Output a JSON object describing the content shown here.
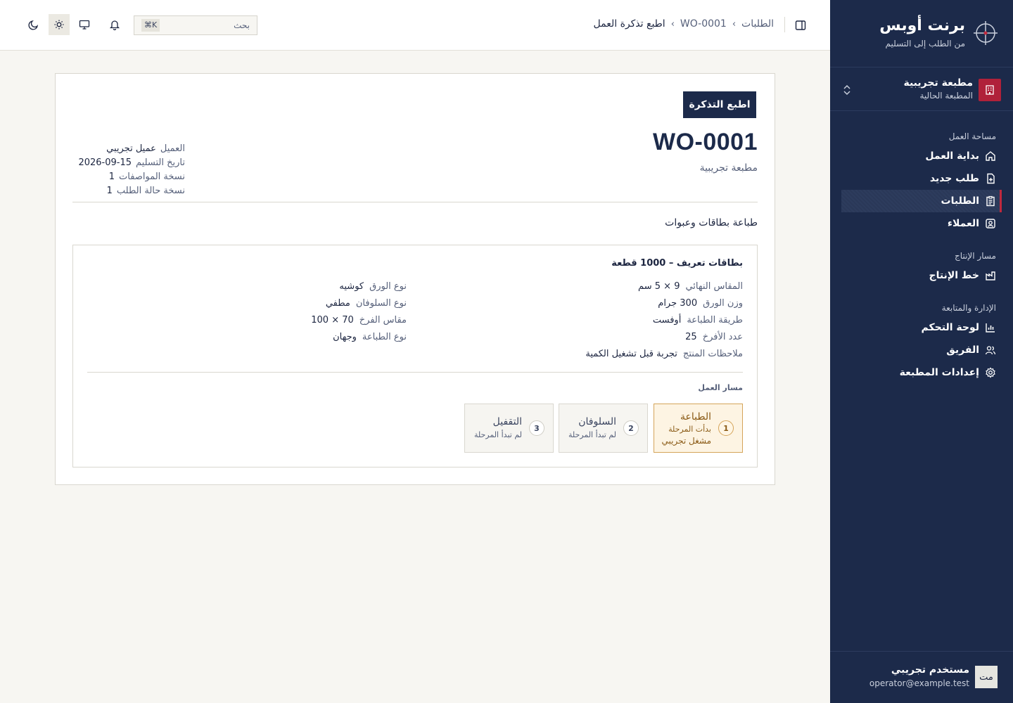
{
  "brand": {
    "title": "برنت أوبس",
    "subtitle": "من الطلب إلى التسليم"
  },
  "org": {
    "name": "مطبعة تجريبية",
    "subtitle": "المطبعة الحالية"
  },
  "nav": {
    "sections": [
      {
        "title": "مساحة العمل",
        "items": [
          {
            "label": "بداية العمل",
            "icon": "home-icon"
          },
          {
            "label": "طلب جديد",
            "icon": "file-plus-icon"
          },
          {
            "label": "الطلبات",
            "icon": "clipboard-icon",
            "active": true
          },
          {
            "label": "العملاء",
            "icon": "contact-icon"
          }
        ]
      },
      {
        "title": "مسار الإنتاج",
        "items": [
          {
            "label": "خط الإنتاج",
            "icon": "factory-icon"
          }
        ]
      },
      {
        "title": "الإدارة والمتابعة",
        "items": [
          {
            "label": "لوحة التحكم",
            "icon": "bar-chart-icon"
          },
          {
            "label": "الفريق",
            "icon": "users-icon"
          },
          {
            "label": "إعدادات المطبعة",
            "icon": "gear-icon"
          }
        ]
      }
    ]
  },
  "user": {
    "initials": "مت",
    "name": "مستخدم تجريبي",
    "email": "operator@example.test"
  },
  "topbar": {
    "breadcrumb": {
      "root": "الطلبات",
      "order": "WO-0001",
      "current": "اطبع تذكرة العمل"
    },
    "search": {
      "placeholder": "بحث",
      "shortcut": "⌘K"
    }
  },
  "ticket": {
    "print_label": "اطبع التذكرة",
    "number": "WO-0001",
    "shop": "مطبعة تجريبية",
    "meta": {
      "customer_label": "العميل",
      "customer": "عميل تجريبي",
      "delivery_label": "تاريخ التسليم",
      "delivery": "2026-09-15",
      "spec_version_label": "نسخة المواصفات",
      "spec_version": "1",
      "status_version_label": "نسخة حالة الطلب",
      "status_version": "1"
    },
    "job_title": "طباعة بطاقات وعبوات",
    "item": {
      "title": "بطاقات تعريف – 1000 قطعة",
      "specs_right": [
        {
          "label": "المقاس النهائي",
          "value": "9 × 5 سم"
        },
        {
          "label": "وزن الورق",
          "value": "300 جرام"
        },
        {
          "label": "طريقة الطباعة",
          "value": "أوفست"
        },
        {
          "label": "عدد الأفرخ",
          "value": "25"
        },
        {
          "label": "ملاحظات المنتج",
          "value": "تجربة قبل تشغيل الكمية"
        }
      ],
      "specs_left": [
        {
          "label": "نوع الورق",
          "value": "كوشيه"
        },
        {
          "label": "نوع السلوفان",
          "value": "مطفي"
        },
        {
          "label": "مقاس الفرخ",
          "value": "70 × 100"
        },
        {
          "label": "نوع الطباعة",
          "value": "وجهان"
        }
      ],
      "workflow_label": "مسار العمل",
      "stages": [
        {
          "num": "1",
          "name": "الطباعة",
          "status": "بدأت المرحلة",
          "operator": "مشغل تجريبي",
          "active": true
        },
        {
          "num": "2",
          "name": "السلوفان",
          "status": "لم تبدأ المرحلة"
        },
        {
          "num": "3",
          "name": "التقفيل",
          "status": "لم تبدأ المرحلة"
        }
      ]
    }
  },
  "colors": {
    "sidebar": "#1c2a4a",
    "accent": "#b0213a",
    "active_stage": "#d4a45a"
  }
}
